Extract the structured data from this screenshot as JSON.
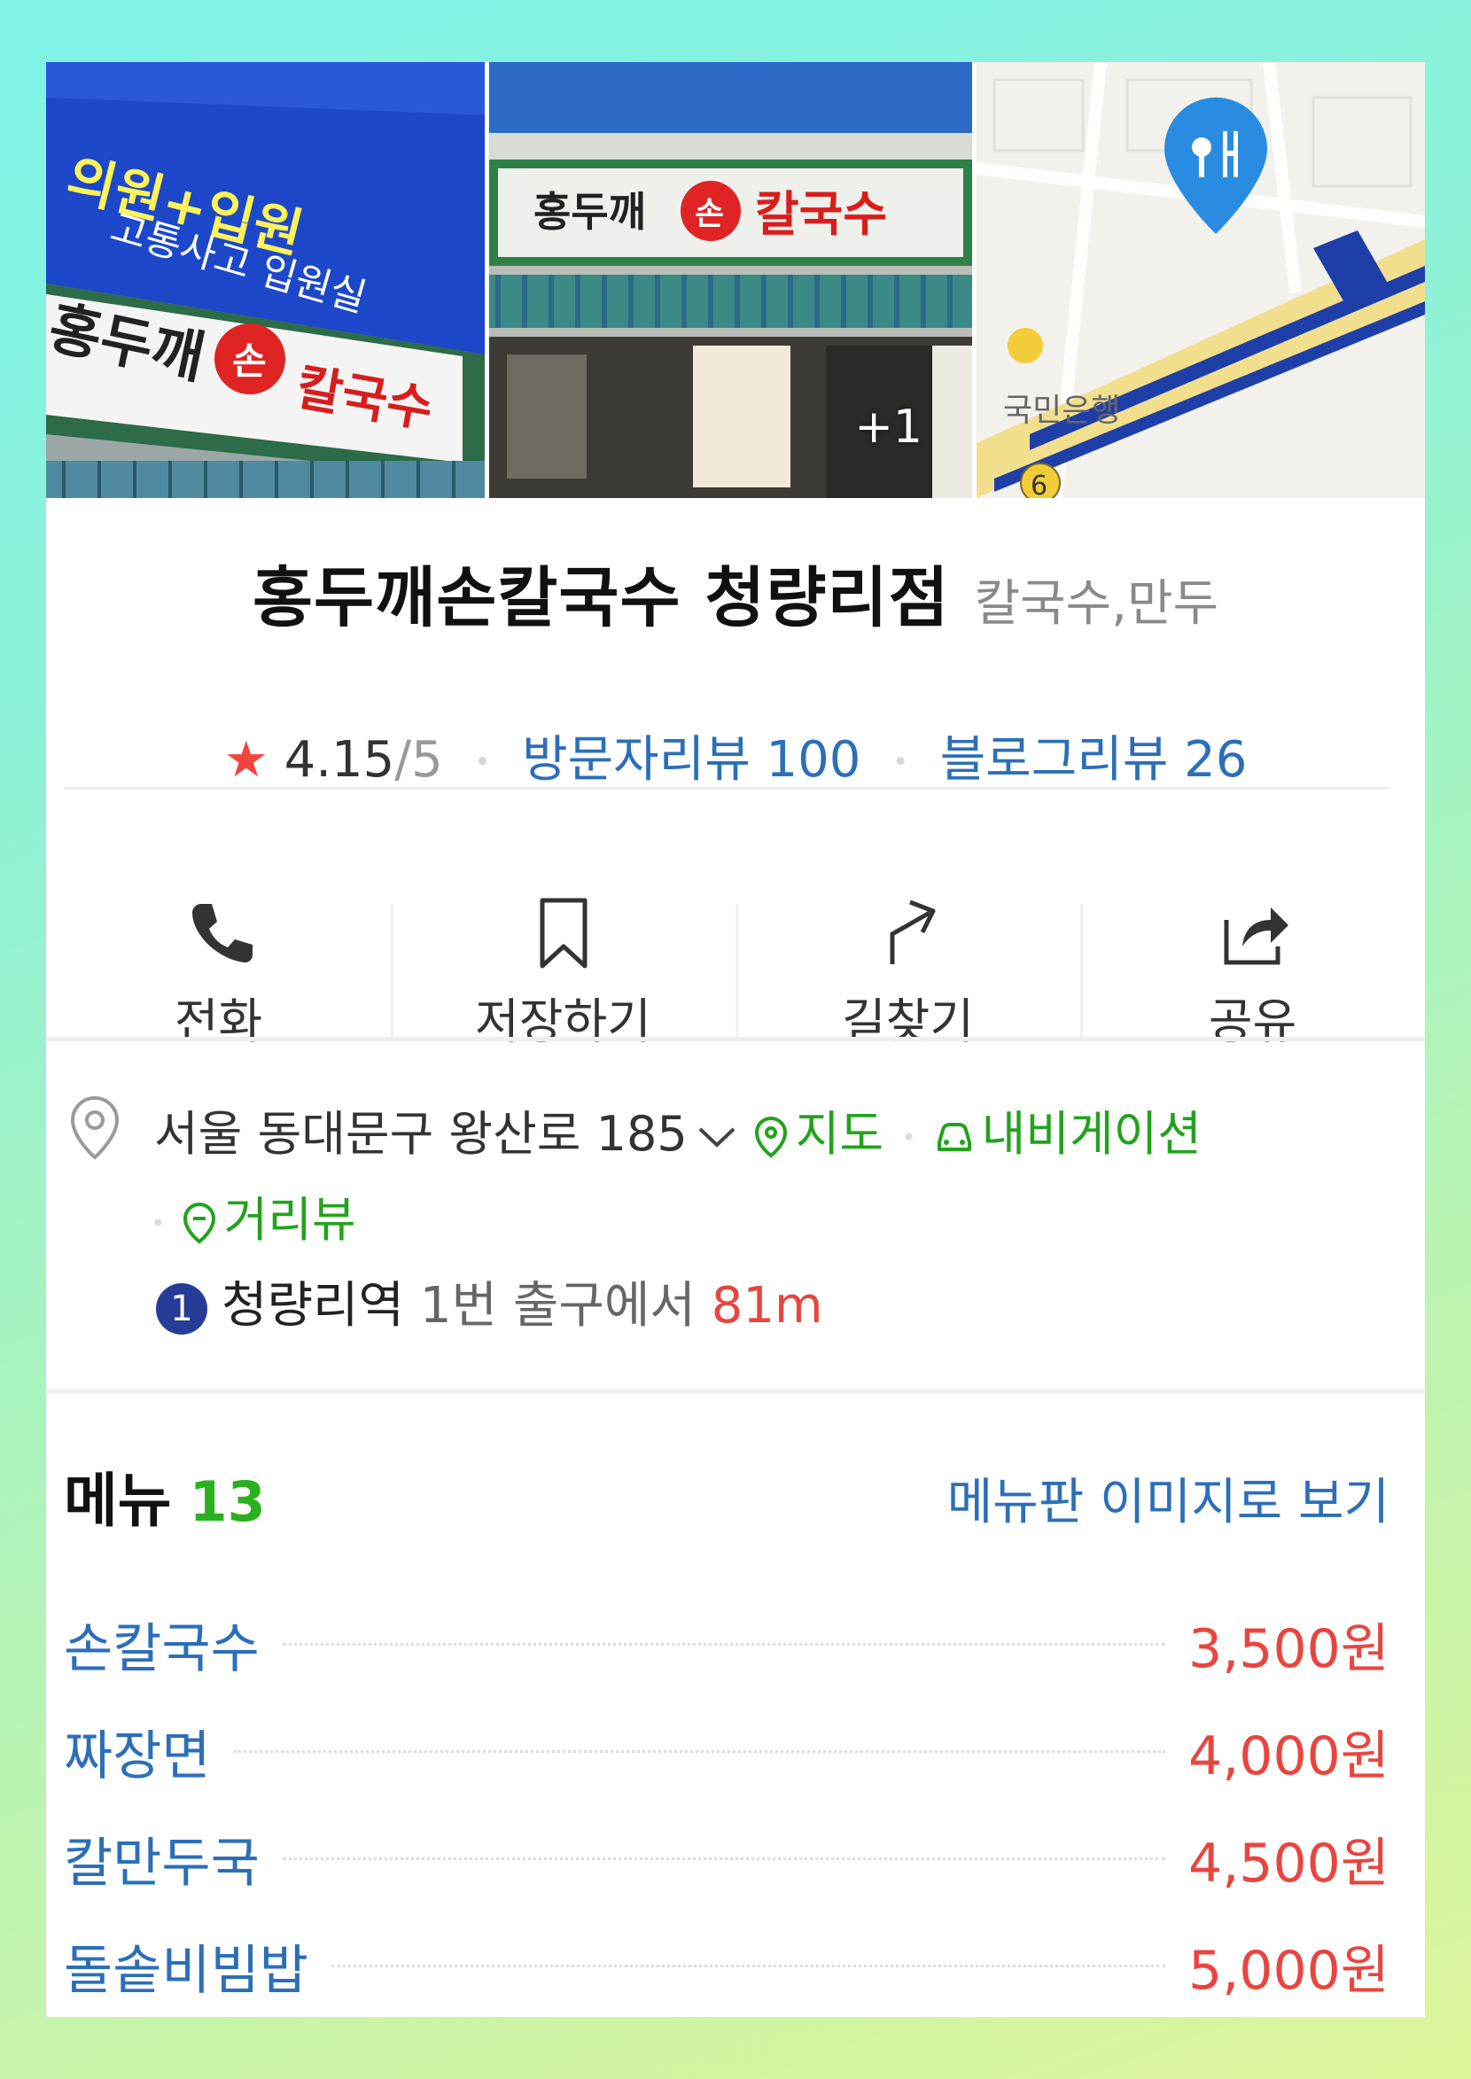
{
  "photos": {
    "more_count": "+1",
    "sign_text": "홍두깨",
    "sign_badge": "손",
    "sign_main": "칼국수",
    "banner_text": "고통사고 입원실",
    "map_bank_label": "국민은행",
    "map_exit_number": "6"
  },
  "place": {
    "name": "홍두깨손칼국수 청량리점",
    "category": "칼국수,만두",
    "rating": "4.15",
    "rating_max": "/5",
    "visitor_reviews": "방문자리뷰 100",
    "blog_reviews": "블로그리뷰 26"
  },
  "actions": [
    {
      "label": "전화",
      "icon": "phone-icon"
    },
    {
      "label": "저장하기",
      "icon": "bookmark-icon"
    },
    {
      "label": "길찾기",
      "icon": "directions-icon"
    },
    {
      "label": "공유",
      "icon": "share-icon"
    }
  ],
  "address": {
    "text": "서울 동대문구 왕산로 185",
    "map_link": "지도",
    "nav_link": "내비게이션",
    "street_view_link": "거리뷰"
  },
  "transit": {
    "line": "1",
    "station": "청량리역",
    "exit_text": "1번 출구에서",
    "distance": "81m"
  },
  "menu": {
    "title": "메뉴",
    "count": "13",
    "image_link": "메뉴판 이미지로 보기",
    "items": [
      {
        "name": "손칼국수",
        "price": "3,500원"
      },
      {
        "name": "짜장면",
        "price": "4,000원"
      },
      {
        "name": "칼만두국",
        "price": "4,500원"
      },
      {
        "name": "돌솥비빔밥",
        "price": "5,000원"
      }
    ]
  },
  "colors": {
    "link_blue": "#2c6fb8",
    "price_red": "#e9453f",
    "accent_green": "#21a31c",
    "star": "#f1443f",
    "subway_line1": "#263c96"
  }
}
